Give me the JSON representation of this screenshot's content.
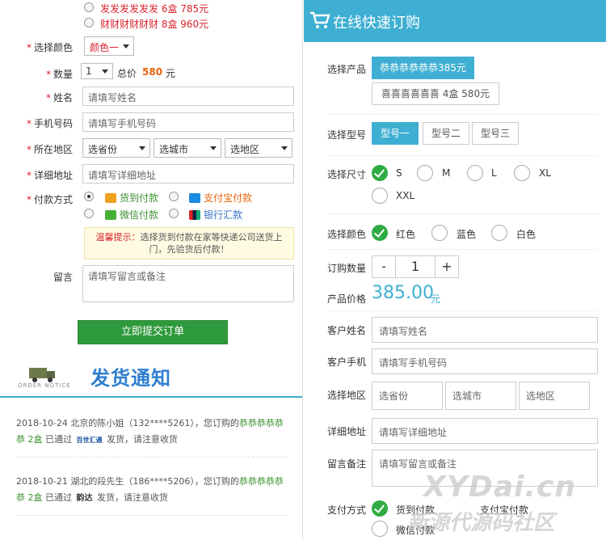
{
  "left": {
    "top_options": [
      {
        "label": "发发发发发发 6盒 785元"
      },
      {
        "label": "财财财财财财 8盒 960元"
      }
    ],
    "color_label": "选择颜色",
    "color_value": "颜色一",
    "qty_label": "数量",
    "qty_value": "1",
    "total_label": "总价",
    "total_value": "580",
    "total_unit": "元",
    "name_label": "姓名",
    "name_ph": "请填写姓名",
    "phone_label": "手机号码",
    "phone_ph": "请填写手机号码",
    "region_label": "所在地区",
    "province": "选省份",
    "city": "选城市",
    "district": "选地区",
    "address_label": "详细地址",
    "address_ph": "请填写详细地址",
    "pay_label": "付款方式",
    "pay": {
      "cod": "货到付款",
      "alipay": "支付宝付款",
      "wechat": "微信付款",
      "bank": "银行汇款"
    },
    "tip_head": "温馨提示：",
    "tip_body": "选择货到付款在家等快递公司送货上门，先验货后付款！",
    "msg_label": "留言",
    "msg_ph": "请填写留言或备注",
    "submit": "立即提交订单",
    "notice_small": "ORDER NOTICE",
    "notice_title": "发货通知",
    "notices": [
      {
        "pre": "2018-10-24 北京的陈小姐（132****5261），您订购的",
        "item": "恭恭恭恭恭恭 2盒",
        "mid": "已通过",
        "carrier": "百世汇通",
        "post": "发货，请注意收货"
      },
      {
        "pre": "2018-10-21 湖北的段先生（186****5206），您订购的",
        "item": "恭恭恭恭恭恭 2盒",
        "mid": "已通过",
        "carrier": "韵达",
        "post": "发货，请注意收货"
      }
    ]
  },
  "right": {
    "header_title": "在线快速订购",
    "product_label": "选择产品",
    "products": [
      {
        "label": "恭恭恭恭恭恭385元"
      },
      {
        "label": "喜喜喜喜喜喜 4盒 580元"
      }
    ],
    "model_label": "选择型号",
    "models": [
      {
        "label": "型号一"
      },
      {
        "label": "型号二"
      },
      {
        "label": "型号三"
      }
    ],
    "size_label": "选择尺寸",
    "sizes": [
      {
        "label": "S"
      },
      {
        "label": "M"
      },
      {
        "label": "L"
      },
      {
        "label": "XL"
      },
      {
        "label": "XXL"
      }
    ],
    "color_label": "选择颜色",
    "colors": [
      {
        "label": "红色"
      },
      {
        "label": "蓝色"
      },
      {
        "label": "白色"
      }
    ],
    "qty_label": "订购数量",
    "qty_minus": "-",
    "qty_value": "1",
    "qty_plus": "+",
    "price_label": "产品价格",
    "price_value": "385.00",
    "price_unit": "元",
    "name_label": "客户姓名",
    "name_ph": "请填写姓名",
    "phone_label": "客户手机",
    "phone_ph": "请填写手机号码",
    "region_label": "选择地区",
    "province": "选省份",
    "city": "选城市",
    "district": "选地区",
    "address_label": "详细地址",
    "address_ph": "请填写详细地址",
    "msg_label": "留言备注",
    "msg_ph": "请填写留言或备注",
    "pay_label": "支付方式",
    "pay_cod": "货到付款",
    "pay_alipay": "支付宝付款",
    "pay_other": "微信付款",
    "watermark1": "XYDai.cn",
    "watermark2": "新源代源码社区"
  },
  "colors": {
    "accent_blue": "#3eafd2",
    "green": "#2f9a3d",
    "red": "#d9232d",
    "orange": "#e8630a"
  }
}
